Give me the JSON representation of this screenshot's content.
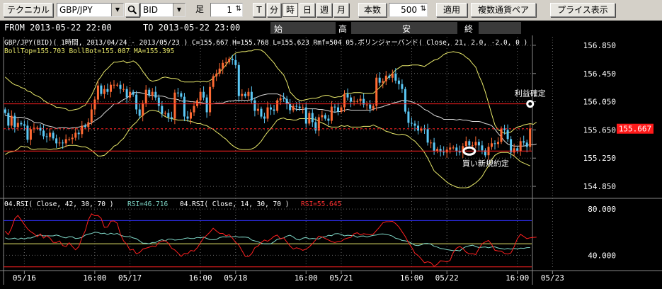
{
  "toolbar": {
    "technical": "テクニカル",
    "symbol": "GBP/JPY",
    "price_type": "BID",
    "ashi_label": "足",
    "ashi_value": "1",
    "timeframes": [
      "T",
      "分",
      "時",
      "日",
      "週",
      "月"
    ],
    "active_timeframe": "時",
    "count_label": "本数",
    "count_value": "500",
    "apply": "適用",
    "multi_pair": "複数通貨ペア",
    "price_display": "プライス表示"
  },
  "infobar": {
    "from": "FROM 2013-05-22  22:00",
    "to": "TO  2013-05-22  23:00",
    "open_label": "始",
    "high_label": "高",
    "low_label": "安",
    "close_label": "終"
  },
  "colors": {
    "background": "#000000",
    "bull": "#ff6a33",
    "bear": "#5bc8f5",
    "band_upper": "#e8e86a",
    "band_lower": "#e8e86a",
    "ma": "#d8d8d8",
    "rsi_long": "#7fd8c8",
    "rsi_short": "#ff2020",
    "level_line": "#ff2020",
    "ob_line": "#3030ff",
    "os_line": "#ff2020",
    "grid": "#6a6a6a"
  },
  "chart_data": [
    {
      "type": "candlestick",
      "title": "GBP/JPY(BID)( 1時間, 2013/04/24 - 2013/05/23 ) C=155.667 H=155.768 L=155.623 Rmf=504   05.ボリンジャーバンド( Close, 21, 2.0, -2.0, 0 )",
      "subtitle": "BollTop=155.703 BollBot=155.087 MA=155.395",
      "ylim": [
        154.7,
        156.97
      ],
      "y_ticks": [
        "156.850",
        "156.450",
        "156.050",
        "155.650",
        "155.250",
        "154.850"
      ],
      "y_tick_values": [
        156.85,
        156.45,
        156.05,
        155.65,
        155.25,
        154.85
      ],
      "current_price_label": "155.667",
      "current_price": 155.667,
      "x_ticks": [
        "05/16",
        "16:00",
        "05/17",
        "16:00",
        "05/18",
        "16:00",
        "05/21",
        "16:00",
        "05/22",
        "16:00",
        "05/23"
      ],
      "x_tick_index": [
        6,
        28,
        39,
        61,
        72,
        94,
        105,
        127,
        138,
        160,
        171
      ],
      "annotations": [
        {
          "text": "利益確定",
          "index": 164,
          "price": 156.02
        },
        {
          "text": "買い新規約定",
          "index": 145,
          "price": 155.35
        }
      ],
      "levels": [
        156.02,
        155.35
      ],
      "closes": [
        155.89,
        155.71,
        155.85,
        155.69,
        155.75,
        155.73,
        155.71,
        155.51,
        155.66,
        155.68,
        155.68,
        155.64,
        155.56,
        155.55,
        155.61,
        155.53,
        155.46,
        155.47,
        155.46,
        155.52,
        155.52,
        155.54,
        155.61,
        155.59,
        155.71,
        155.69,
        155.76,
        155.94,
        156.08,
        156.28,
        156.16,
        156.23,
        156.19,
        156.29,
        156.29,
        156.29,
        156.23,
        156.23,
        156.11,
        156.19,
        156.15,
        155.94,
        155.85,
        156.03,
        156.22,
        156.14,
        156.19,
        156.11,
        155.99,
        155.88,
        155.89,
        155.83,
        155.81,
        156.18,
        156.17,
        156.12,
        155.84,
        155.81,
        155.9,
        155.99,
        156.07,
        156.19,
        156.11,
        155.9,
        156.26,
        156.41,
        156.45,
        156.52,
        156.6,
        156.61,
        156.66,
        156.64,
        156.57,
        156.13,
        156.16,
        156.13,
        156.19,
        156.07,
        155.92,
        155.95,
        155.84,
        155.81,
        155.97,
        155.94,
        155.92,
        156.07,
        156.1,
        156.09,
        156.02,
        155.93,
        155.99,
        155.98,
        155.96,
        155.97,
        155.74,
        155.89,
        155.76,
        155.64,
        155.83,
        155.86,
        155.81,
        155.78,
        155.98,
        155.97,
        155.91,
        155.97,
        156.16,
        156.11,
        156.05,
        156.06,
        156.06,
        156.09,
        156.01,
        156.01,
        155.95,
        155.99,
        156.39,
        156.32,
        156.34,
        156.42,
        156.39,
        156.45,
        156.35,
        156.3,
        156.23,
        155.91,
        155.75,
        155.74,
        155.71,
        155.64,
        155.67,
        155.66,
        155.47,
        155.47,
        155.35,
        155.38,
        155.34,
        155.33,
        155.37,
        155.4,
        155.4,
        155.35,
        155.33,
        155.42,
        155.49,
        155.43,
        155.43,
        155.48,
        155.43,
        155.36,
        155.29,
        155.41,
        155.46,
        155.45,
        155.48,
        155.67,
        155.65,
        155.52,
        155.33,
        155.39,
        155.35,
        155.49,
        155.47,
        155.41,
        155.67
      ],
      "bb_upper": [
        156.4,
        156.36,
        156.32,
        156.29,
        156.28,
        156.25,
        156.24,
        156.2,
        156.19,
        156.15,
        156.13,
        156.11,
        156.07,
        156.04,
        156.02,
        156.0,
        155.97,
        155.97,
        155.96,
        155.95,
        155.92,
        155.93,
        155.94,
        155.95,
        155.98,
        156.0,
        156.07,
        156.14,
        156.24,
        156.35,
        156.41,
        156.48,
        156.52,
        156.57,
        156.61,
        156.61,
        156.62,
        156.63,
        156.6,
        156.61,
        156.63,
        156.6,
        156.55,
        156.48,
        156.42,
        156.36,
        156.34,
        156.35,
        156.36,
        156.39,
        156.4,
        156.39,
        156.38,
        156.38,
        156.37,
        156.34,
        156.33,
        156.33,
        156.33,
        156.33,
        156.34,
        156.33,
        156.34,
        156.33,
        156.35,
        156.38,
        156.43,
        156.47,
        156.52,
        156.57,
        156.64,
        156.7,
        156.74,
        156.75,
        156.76,
        156.76,
        156.77,
        156.77,
        156.79,
        156.79,
        156.78,
        156.75,
        156.7,
        156.65,
        156.6,
        156.53,
        156.48,
        156.43,
        156.33,
        156.19,
        156.14,
        156.09,
        156.07,
        156.07,
        156.08,
        156.09,
        156.1,
        156.1,
        156.11,
        156.13,
        156.14,
        156.14,
        156.12,
        156.11,
        156.12,
        156.12,
        156.16,
        156.17,
        156.17,
        156.18,
        156.18,
        156.18,
        156.17,
        156.17,
        156.17,
        156.17,
        156.21,
        156.25,
        156.3,
        156.36,
        156.41,
        156.45,
        156.5,
        156.53,
        156.56,
        156.56,
        156.56,
        156.57,
        156.57,
        156.57,
        156.56,
        156.55,
        156.58,
        156.61,
        156.64,
        156.65,
        156.68,
        156.72,
        156.74,
        156.75,
        156.76,
        156.75,
        156.74,
        156.72,
        156.68,
        156.65,
        156.59,
        156.54,
        156.42,
        156.32,
        156.19,
        156.03,
        155.87,
        155.72,
        155.65,
        155.63,
        155.6,
        155.61,
        155.62,
        155.66,
        155.69,
        155.7,
        155.72,
        155.73,
        155.74,
        155.73,
        155.76
      ],
      "bb_lower": [
        155.3,
        155.33,
        155.34,
        155.35,
        155.38,
        155.42,
        155.41,
        155.41,
        155.38,
        155.37,
        155.38,
        155.38,
        155.38,
        155.38,
        155.37,
        155.38,
        155.38,
        155.39,
        155.4,
        155.42,
        155.43,
        155.43,
        155.43,
        155.42,
        155.41,
        155.41,
        155.39,
        155.36,
        155.32,
        155.28,
        155.28,
        155.29,
        155.33,
        155.37,
        155.42,
        155.44,
        155.49,
        155.53,
        155.6,
        155.67,
        155.72,
        155.76,
        155.82,
        155.86,
        155.89,
        155.92,
        155.93,
        155.92,
        155.91,
        155.87,
        155.84,
        155.82,
        155.81,
        155.8,
        155.79,
        155.79,
        155.79,
        155.78,
        155.77,
        155.76,
        155.74,
        155.74,
        155.72,
        155.71,
        155.68,
        155.66,
        155.62,
        155.59,
        155.55,
        155.52,
        155.47,
        155.43,
        155.4,
        155.38,
        155.37,
        155.37,
        155.37,
        155.38,
        155.4,
        155.44,
        155.49,
        155.56,
        155.62,
        155.67,
        155.73,
        155.79,
        155.81,
        155.82,
        155.8,
        155.8,
        155.79,
        155.79,
        155.81,
        155.81,
        155.81,
        155.81,
        155.81,
        155.8,
        155.77,
        155.75,
        155.73,
        155.7,
        155.69,
        155.69,
        155.69,
        155.71,
        155.7,
        155.71,
        155.69,
        155.69,
        155.69,
        155.69,
        155.7,
        155.7,
        155.7,
        155.72,
        155.7,
        155.68,
        155.66,
        155.63,
        155.62,
        155.6,
        155.59,
        155.58,
        155.59,
        155.58,
        155.56,
        155.52,
        155.49,
        155.44,
        155.39,
        155.33,
        155.25,
        155.16,
        155.07,
        155.03,
        154.99,
        154.95,
        154.91,
        154.88,
        154.86,
        154.84,
        154.83,
        154.83,
        154.83,
        154.84,
        154.87,
        154.9,
        154.94,
        154.99,
        155.07,
        155.14,
        155.23,
        155.29,
        155.32,
        155.33,
        155.33,
        155.33,
        155.31,
        155.28,
        155.24,
        155.2,
        155.18,
        155.16,
        155.14
      ],
      "ma": [
        155.85,
        155.85,
        155.83,
        155.82,
        155.83,
        155.83,
        155.82,
        155.81,
        155.79,
        155.76,
        155.75,
        155.75,
        155.73,
        155.71,
        155.7,
        155.69,
        155.67,
        155.68,
        155.68,
        155.68,
        155.67,
        155.68,
        155.68,
        155.69,
        155.7,
        155.71,
        155.73,
        155.75,
        155.78,
        155.81,
        155.84,
        155.89,
        155.93,
        155.97,
        156.02,
        156.02,
        156.05,
        156.08,
        156.1,
        156.14,
        156.18,
        156.18,
        156.18,
        156.17,
        156.16,
        156.14,
        156.14,
        156.13,
        156.13,
        156.13,
        156.12,
        156.1,
        156.09,
        156.09,
        156.08,
        156.06,
        156.06,
        156.06,
        156.05,
        156.05,
        156.04,
        156.04,
        156.03,
        156.02,
        156.02,
        156.02,
        156.03,
        156.03,
        156.03,
        156.05,
        156.06,
        156.06,
        156.07,
        156.07,
        156.07,
        156.07,
        156.07,
        156.08,
        156.1,
        156.12,
        156.14,
        156.15,
        156.16,
        156.16,
        156.16,
        156.16,
        156.14,
        156.12,
        156.07,
        156.0,
        155.96,
        155.94,
        155.94,
        155.94,
        155.95,
        155.95,
        155.95,
        155.95,
        155.94,
        155.94,
        155.93,
        155.92,
        155.91,
        155.9,
        155.91,
        155.91,
        155.93,
        155.94,
        155.93,
        155.93,
        155.93,
        155.93,
        155.93,
        155.93,
        155.93,
        155.94,
        155.96,
        155.97,
        155.98,
        156.0,
        156.01,
        156.03,
        156.04,
        156.05,
        156.07,
        156.07,
        156.06,
        156.05,
        156.03,
        156.01,
        155.98,
        155.94,
        155.92,
        155.89,
        155.86,
        155.84,
        155.83,
        155.8,
        155.8,
        155.8,
        155.8,
        155.79,
        155.8,
        155.79,
        155.79,
        155.78,
        155.77,
        155.77,
        155.77,
        155.76,
        155.74,
        155.73,
        155.71,
        155.66,
        155.6,
        155.55,
        155.49,
        155.45,
        155.43,
        155.42,
        155.42,
        155.42,
        155.42,
        155.43,
        155.44,
        155.44,
        155.45
      ]
    },
    {
      "type": "line",
      "title": "04.RSI( Close, 42, 30, 70 )",
      "series": [
        {
          "name": "RSI=46.716",
          "values": [
            55.1,
            54.0,
            54.3,
            54.8,
            53.7,
            54.8,
            54.0,
            55.0,
            54.9,
            55.9,
            57.2,
            57.5,
            56.8,
            56.9,
            56.8,
            56.8,
            57.5,
            56.8,
            55.6,
            55.0,
            56.1,
            55.9,
            54.5,
            54.8,
            55.5,
            57.4,
            58.3,
            58.8,
            60.0,
            59.7,
            58.7,
            59.1,
            57.9,
            59.1,
            58.2,
            58.9,
            57.3,
            56.5,
            56.1,
            56.1,
            55.0,
            54.3,
            52.4,
            50.4,
            50.4,
            50.0,
            51.0,
            51.1,
            52.6,
            53.5,
            52.4,
            54.0,
            54.0,
            53.1,
            53.4,
            53.5,
            54.5,
            55.0,
            54.5,
            54.6,
            55.4,
            55.2,
            55.7,
            54.6,
            53.6,
            53.5,
            53.7,
            55.3,
            55.9,
            55.8,
            55.9,
            56.0,
            56.3,
            55.6,
            55.8,
            55.7,
            55.3,
            53.2,
            52.4,
            51.7,
            50.5,
            49.8,
            49.8,
            49.9,
            51.7,
            53.8,
            54.4,
            55.0,
            56.6,
            57.4,
            55.8,
            53.8,
            53.2,
            54.8,
            55.4,
            54.2,
            54.6,
            54.3,
            54.1,
            55.8,
            55.9,
            57.3,
            56.9,
            58.6,
            58.8,
            58.0,
            56.8,
            57.3,
            57.1,
            56.9,
            55.5,
            56.5,
            56.7,
            55.8,
            56.5,
            57.2,
            57.6,
            58.3,
            58.4,
            58.0,
            57.5,
            56.6,
            54.7,
            54.1,
            52.8,
            52.5,
            51.8,
            50.2,
            48.7,
            48.4,
            49.1,
            50.2,
            50.3,
            49.6,
            47.8,
            47.1,
            45.9,
            45.5,
            44.9,
            44.5,
            44.0,
            44.3,
            43.8,
            46.0,
            47.5,
            48.2,
            48.7,
            47.6,
            46.7,
            47.0,
            47.2,
            46.4,
            47.2,
            47.3,
            46.3,
            45.8,
            45.3,
            45.9,
            45.4,
            45.9,
            45.5,
            46.2,
            46.0,
            46.6,
            46.7
          ]
        },
        {
          "name": "RSI=55.645",
          "values": [
            60.8,
            57.8,
            63.6,
            71.6,
            74.5,
            70.5,
            66.7,
            62.8,
            60.4,
            58.7,
            56.0,
            58.5,
            54.9,
            56.9,
            54.8,
            51.2,
            51.0,
            52.4,
            48.4,
            47.5,
            50.8,
            47.5,
            44.7,
            47.4,
            55.3,
            61.0,
            70.7,
            75.9,
            74.2,
            74.4,
            71.9,
            64.1,
            64.4,
            69.5,
            69.7,
            67.7,
            58.3,
            52.4,
            49.5,
            44.5,
            45.2,
            41.3,
            42.4,
            45.4,
            46.1,
            47.0,
            48.0,
            47.6,
            51.1,
            52.3,
            52.5,
            50.5,
            46.1,
            44.6,
            41.9,
            39.1,
            41.6,
            41.3,
            44.2,
            43.6,
            46.4,
            50.7,
            55.1,
            57.3,
            60.1,
            63.4,
            61.0,
            58.9,
            58.9,
            56.8,
            57.8,
            54.8,
            51.1,
            48.9,
            44.0,
            39.0,
            38.9,
            41.3,
            46.6,
            47.9,
            51.0,
            53.2,
            52.1,
            54.0,
            56.4,
            57.5,
            54.1,
            55.1,
            51.5,
            48.0,
            45.4,
            46.5,
            45.7,
            44.3,
            45.4,
            47.3,
            50.1,
            53.2,
            56.6,
            55.8,
            54.5,
            53.2,
            51.8,
            51.0,
            51.9,
            52.1,
            54.1,
            54.9,
            55.5,
            58.7,
            59.5,
            57.6,
            58.7,
            58.2,
            57.7,
            58.3,
            61.4,
            64.5,
            68.1,
            69.0,
            69.1,
            69.3,
            67.4,
            64.5,
            60.3,
            56.2,
            50.9,
            46.8,
            41.7,
            39.9,
            36.8,
            33.6,
            34.4,
            33.6,
            30.5,
            32.3,
            35.2,
            34.9,
            34.2,
            35.6,
            42.4,
            46.1,
            47.7,
            45.8,
            42.7,
            41.2,
            41.4,
            40.6,
            45.7,
            50.0,
            51.6,
            52.8,
            49.3,
            44.3,
            43.8,
            43.6,
            41.6,
            41.1,
            42.0,
            47.3,
            54.3,
            58.1,
            56.3,
            54.4,
            55.1,
            55.5,
            55.6
          ]
        }
      ],
      "ylim": [
        28,
        88
      ],
      "y_ticks": [
        "80.000",
        "40.000"
      ],
      "y_tick_values": [
        80,
        40
      ],
      "levels": [
        70,
        30
      ]
    }
  ]
}
